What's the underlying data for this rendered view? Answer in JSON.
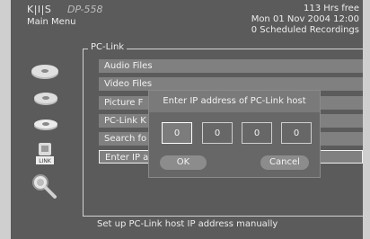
{
  "header": {
    "logo": "K|I|S",
    "model": "DP-558",
    "menu_title": "Main Menu",
    "free_space": "113 Hrs free",
    "datetime": "Mon 01 Nov 2004 12:00",
    "recordings": "0 Scheduled Recordings"
  },
  "pclink": {
    "title": "PC-Link",
    "items": [
      {
        "label": "Audio Files"
      },
      {
        "label": "Video Files"
      },
      {
        "label": "Picture F"
      },
      {
        "label": "PC-Link K"
      },
      {
        "label": "Search fo"
      },
      {
        "label": "Enter IP a"
      }
    ]
  },
  "sidebar": {
    "icons": [
      "music-disc-icon",
      "video-disc-icon",
      "picture-disc-icon",
      "pc-link-icon",
      "search-icon"
    ],
    "pc_link_text": "LINK"
  },
  "dialog": {
    "title": "Enter IP address of PC-Link host",
    "octets": [
      "0",
      "0",
      "0",
      "0"
    ],
    "ok_label": "OK",
    "cancel_label": "Cancel"
  },
  "status": {
    "text": "Set up PC-Link host IP address manually"
  },
  "colors": {
    "screen_bg": "#5b5b5b",
    "item_bg": "#808080",
    "dialog_bg": "#676767"
  }
}
